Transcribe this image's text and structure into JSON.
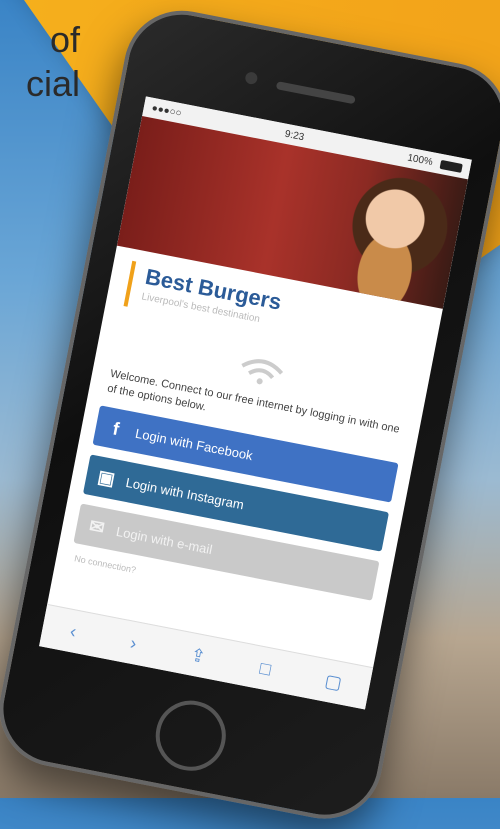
{
  "banner": {
    "line1": "of",
    "line2": "cial"
  },
  "status": {
    "carrier": "●●●○○",
    "time": "9:23",
    "battery": "100%"
  },
  "brand": {
    "title": "Best Burgers",
    "subtitle": "Liverpool's best destination"
  },
  "welcome": "Welcome. Connect to our free internet by logging in with one of the options below.",
  "login": {
    "facebook": "Login with Facebook",
    "instagram": "Login with Instagram",
    "email": "Login with e-mail"
  },
  "footer_note": "No connection?",
  "icons": {
    "facebook": "f",
    "instagram": "▣",
    "email": "✉",
    "wifi": "wifi-icon",
    "back": "‹",
    "forward": "›",
    "share": "⇪",
    "bookmarks": "□",
    "tabs": "▢"
  }
}
